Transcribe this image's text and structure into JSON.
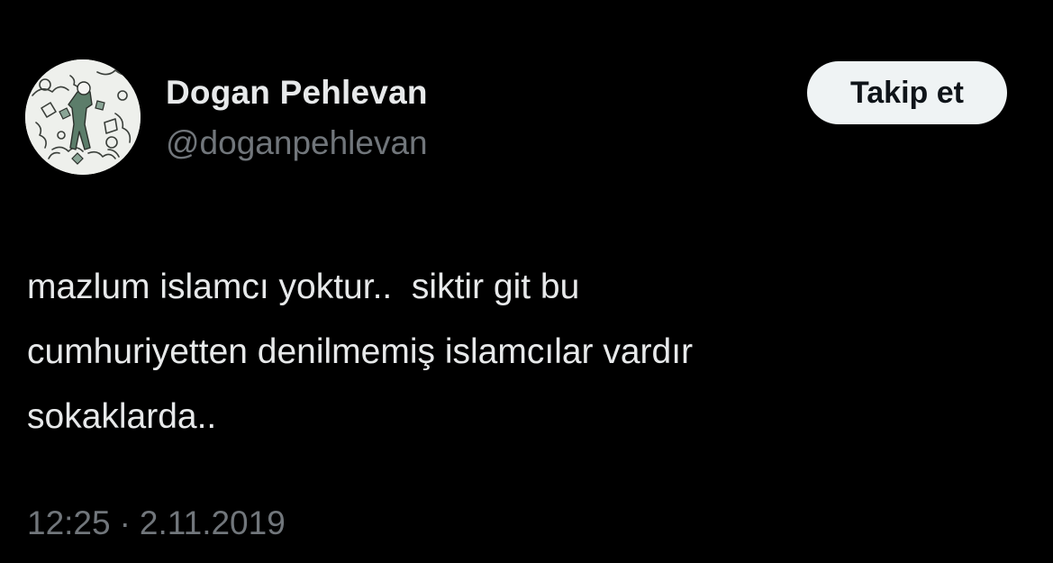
{
  "user": {
    "display_name": "Dogan Pehlevan",
    "handle": "@doganpehlevan",
    "avatar_icon": "illustrated-avatar-icon"
  },
  "follow_button": {
    "label": "Takip et"
  },
  "tweet": {
    "lines": [
      "mazlum islamcı yoktur..  siktir git bu",
      "cumhuriyetten denilmemiş islamcılar vardır",
      "sokaklarda.."
    ]
  },
  "meta": {
    "time": "12:25",
    "separator": "·",
    "date": "2.11.2019"
  },
  "colors": {
    "background": "#000000",
    "primary_text": "#e7e9ea",
    "secondary_text": "#71767b",
    "button_bg": "#eff3f4",
    "button_text": "#0f1419"
  }
}
